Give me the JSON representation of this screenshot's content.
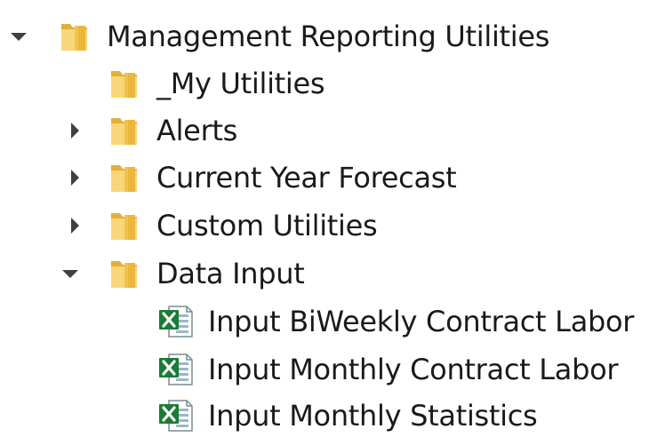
{
  "tree": {
    "root": {
      "label": "Management Reporting Utilities",
      "expanded": true,
      "icon": "folder-icon",
      "children": [
        {
          "label": "_My Utilities",
          "icon": "folder-icon",
          "expandable": false
        },
        {
          "label": "Alerts",
          "icon": "folder-icon",
          "expandable": true,
          "expanded": false
        },
        {
          "label": "Current Year Forecast",
          "icon": "folder-icon",
          "expandable": true,
          "expanded": false
        },
        {
          "label": "Custom Utilities",
          "icon": "folder-icon",
          "expandable": true,
          "expanded": false
        },
        {
          "label": "Data Input",
          "icon": "folder-icon",
          "expandable": true,
          "expanded": true,
          "children": [
            {
              "label": "Input BiWeekly Contract Labor",
              "icon": "excel-file-icon"
            },
            {
              "label": "Input Monthly Contract Labor",
              "icon": "excel-file-icon"
            },
            {
              "label": "Input Monthly Statistics",
              "icon": "excel-file-icon"
            }
          ]
        }
      ]
    }
  },
  "colors": {
    "folder_light": "#f7d77a",
    "folder_dark": "#e0b03a",
    "excel_green": "#1d7a35",
    "caret": "#404040",
    "text": "#1a1a1a"
  }
}
